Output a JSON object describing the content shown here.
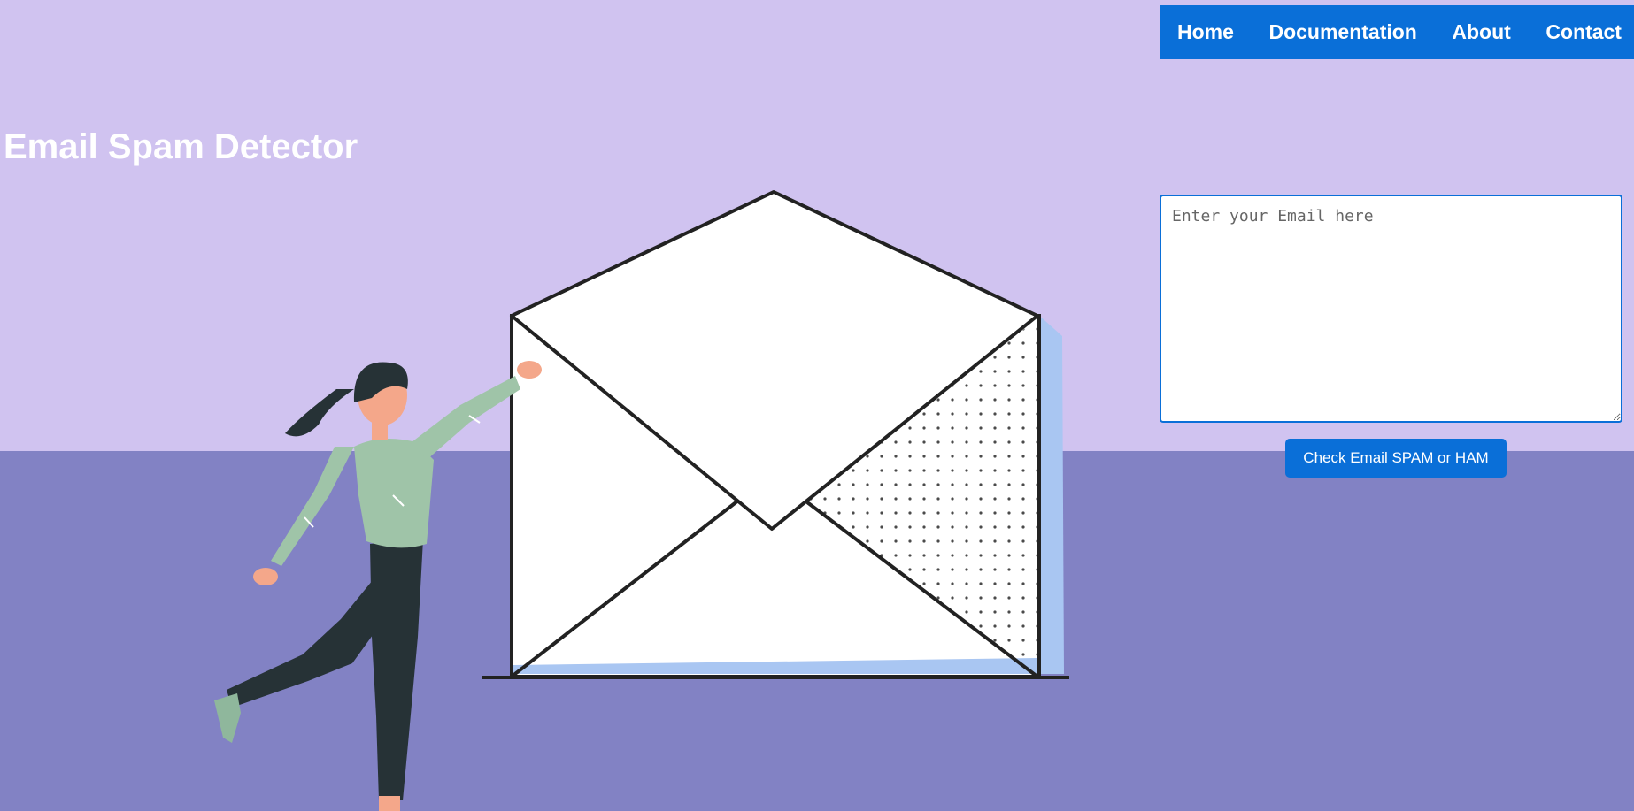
{
  "nav": {
    "items": [
      {
        "label": "Home"
      },
      {
        "label": "Documentation"
      },
      {
        "label": "About"
      },
      {
        "label": "Contact"
      }
    ]
  },
  "hero": {
    "title": "Email Spam Detector"
  },
  "form": {
    "email_placeholder": "Enter your Email here",
    "email_value": "",
    "submit_label": "Check Email SPAM or HAM"
  },
  "colors": {
    "background_top": "#d0c3f0",
    "background_floor": "#8282c4",
    "accent": "#0a6fd8"
  }
}
